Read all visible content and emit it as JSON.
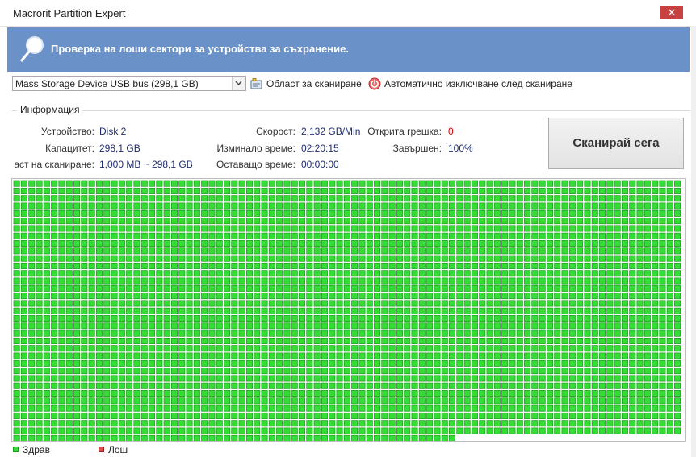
{
  "window": {
    "title": "Macrorit Partition Expert",
    "close_label": "✕"
  },
  "banner": {
    "icon": "magnifier-icon",
    "text": "Проверка на лоши сектори за устройства за съхранение."
  },
  "toolbar": {
    "device_selected": "Mass Storage Device USB bus (298,1 GB)",
    "scan_area_label": "Област за сканиране",
    "auto_shutdown_label": "Автоматично изключване след сканиране"
  },
  "info": {
    "legend": "Информация",
    "device_label": "Устройство:",
    "device_value": "Disk 2",
    "capacity_label": "Капацитет:",
    "capacity_value": "298,1 GB",
    "scan_area_label": "аст на сканиране:",
    "scan_area_value": "1,000 MB ~ 298,1 GB",
    "speed_label": "Скорост:",
    "speed_value": "2,132 GB/Min",
    "elapsed_label": "Изминало време:",
    "elapsed_value": "02:20:15",
    "remaining_label": "Оставащо време:",
    "remaining_value": "00:00:00",
    "errors_label": "Открита грешка:",
    "errors_value": "0",
    "completed_label": "Завършен:",
    "completed_value": "100%"
  },
  "scan_button": {
    "label": "Сканирай сега"
  },
  "sector_map": {
    "columns": 89,
    "full_rows": 34,
    "last_row_blocks": 59,
    "good_color": "#33dd33",
    "good_border": "#1c9a1c",
    "bad_color": "#e04b4b"
  },
  "legend": {
    "good_label": "Здрав",
    "bad_label": "Лош"
  }
}
